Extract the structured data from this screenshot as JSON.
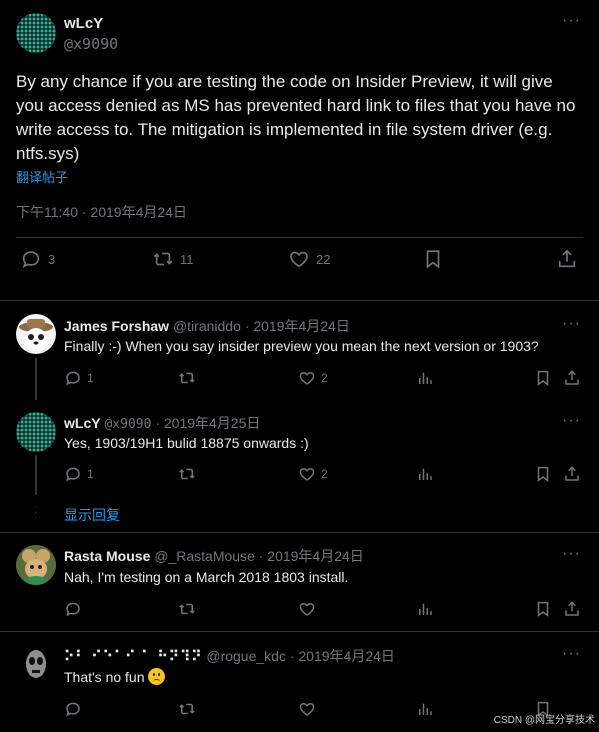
{
  "main_tweet": {
    "author_name": "wLcY",
    "author_handle": "@x9090",
    "text": "By any chance if you are testing the code on Insider Preview, it will give you access denied as MS has prevented hard link to files that you have no write access to. The mitigation is implemented in file system driver (e.g. ntfs.sys)",
    "translate_label": "翻译帖子",
    "timestamp": "下午11:40 · 2019年4月24日",
    "replies_count": "3",
    "retweets_count": "11",
    "likes_count": "22"
  },
  "replies": [
    {
      "author_name": "James Forshaw",
      "author_handle": "@tiraniddo",
      "date": "· 2019年4月24日",
      "text": "Finally :-) When you say insider preview you mean the next version or 1903?",
      "replies_count": "1",
      "likes_count": "2"
    },
    {
      "author_name": "wLcY",
      "author_handle": "@x9090",
      "date": "· 2019年4月25日",
      "text": "Yes, 1903/19H1 bulid 18875 onwards :)",
      "replies_count": "1",
      "likes_count": "2"
    },
    {
      "author_name": "Rasta Mouse",
      "author_handle": "@_RastaMouse",
      "date": "· 2019年4月24日",
      "text": "Nah, I'm testing on a March 2018 1803 install."
    },
    {
      "author_name": "⠕⠃ ⠊⠑⠁⠊ ⠁ ⠓⠝⠹⠝",
      "author_handle": "@rogue_kdc",
      "date": "· 2019年4月24日",
      "text": "That's no fun"
    }
  ],
  "show_replies_label": "显示回复",
  "more_label": "···",
  "watermark": "CSDN @网宝分享技术",
  "colors": {
    "background": "#000000",
    "text": "#e7e9ea",
    "muted": "#71767b",
    "link": "#1d9bf0",
    "border": "#2f3336"
  }
}
